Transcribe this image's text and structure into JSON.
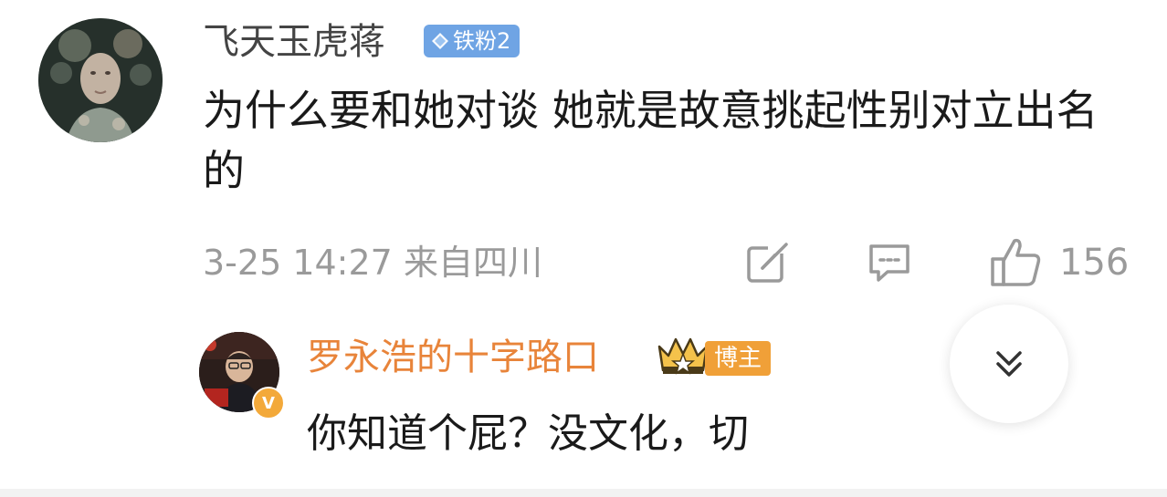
{
  "comment": {
    "username": "飞天玉虎蒋",
    "fan_badge": "铁粉2",
    "text": "为什么要和她对谈  她就是故意挑起性别对立出名的",
    "time": "3-25 14:27",
    "location": "来自四川",
    "like_count": "156",
    "icons": {
      "share": "share-icon",
      "reply": "comment-icon",
      "like": "thumbs-up-icon",
      "fan_badge": "diamond-icon"
    }
  },
  "reply": {
    "username": "罗永浩的十字路口",
    "role_badge": "博主",
    "text": "你知道个屁？没文化，切",
    "verified_mark": "V",
    "icons": {
      "crown": "crown-icon",
      "verified": "verified-icon"
    }
  },
  "expand": {
    "icon": "chevron-double-down-icon"
  },
  "colors": {
    "fan_badge_bg": "#6fa4e4",
    "reply_username": "#e8843a",
    "blogger_badge_bg": "#f0a038",
    "meta_text": "#9a9a9a"
  }
}
